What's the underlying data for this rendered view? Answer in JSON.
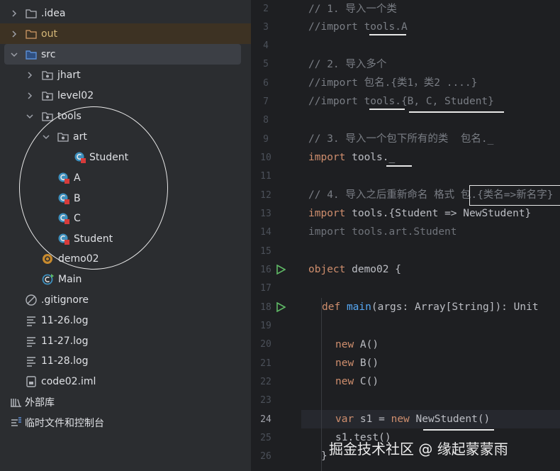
{
  "tree": [
    {
      "label": ".idea",
      "icon": "folder-icon",
      "chevron": "right"
    },
    {
      "label": "out",
      "icon": "folder-icon-orange",
      "chevron": "right",
      "selected": "out"
    },
    {
      "label": "src",
      "icon": "folder-icon-blue",
      "chevron": "down",
      "selected": "src"
    },
    {
      "label": "jhart",
      "icon": "package-icon",
      "chevron": "right"
    },
    {
      "label": "level02",
      "icon": "package-icon",
      "chevron": "right"
    },
    {
      "label": "tools",
      "icon": "package-icon",
      "chevron": "down"
    },
    {
      "label": "art",
      "icon": "package-icon",
      "chevron": "down"
    },
    {
      "label": "Student",
      "icon": "scala-class-icon"
    },
    {
      "label": "A",
      "icon": "scala-class-icon"
    },
    {
      "label": "B",
      "icon": "scala-class-icon"
    },
    {
      "label": "C",
      "icon": "scala-class-icon"
    },
    {
      "label": "Student",
      "icon": "scala-class-icon"
    },
    {
      "label": "demo02",
      "icon": "scala-object-icon"
    },
    {
      "label": "Main",
      "icon": "scala-main-icon"
    },
    {
      "label": ".gitignore",
      "icon": "ignore-file-icon"
    },
    {
      "label": "11-26.log",
      "icon": "text-file-icon"
    },
    {
      "label": "11-27.log",
      "icon": "text-file-icon"
    },
    {
      "label": "11-28.log",
      "icon": "text-file-icon"
    },
    {
      "label": "code02.iml",
      "icon": "module-file-icon"
    },
    {
      "label": "外部库",
      "icon": "library-icon"
    },
    {
      "label": "临时文件和控制台",
      "icon": "scratches-icon"
    }
  ],
  "line_numbers": [
    "2",
    "3",
    "4",
    "5",
    "6",
    "7",
    "8",
    "9",
    "10",
    "11",
    "12",
    "13",
    "14",
    "15",
    "16",
    "17",
    "18",
    "19",
    "20",
    "21",
    "22",
    "23",
    "24",
    "25",
    "26"
  ],
  "current_line": "24",
  "code": {
    "l2_comment": "// 1. 导入一个类",
    "l3_comment": "//import tools.A",
    "l5_comment": "// 2. 导入多个",
    "l6_comment": "//import 包名.{类1，类2 ....}",
    "l7_comment": "//import tools.{B, C, Student}",
    "l9_comment": "// 3. 导入一个包下所有的类  包名._",
    "l10_kw": "import",
    "l10_rest": " tools._",
    "l12_comment": "// 4. 导入之后重新命名 格式 包.{类名=>新名字}",
    "l13_kw": "import",
    "l13_rest": " tools.{Student => NewStudent}",
    "l14_text": "import tools.art.Student",
    "l16_kw": "object",
    "l16_rest": " demo02 {",
    "l18_kw": "def",
    "l18_fn": "main",
    "l18_rest": "(args: Array[String]): Unit",
    "l20_kw": "new",
    "l20_rest": " A()",
    "l21_kw": "new",
    "l21_rest": " B()",
    "l22_kw": "new",
    "l22_rest": " C()",
    "l24_kw1": "var",
    "l24_mid": " s1 = ",
    "l24_kw2": "new",
    "l24_rest": " NewStudent()",
    "l25_text": "s1.test()",
    "l26_text": "}"
  },
  "watermark": "掘金技术社区 @ 缘起蒙蒙雨",
  "colors": {
    "sidebar_bg": "#2b2d30",
    "editor_bg": "#1e1f22",
    "keyword": "#cf8e6d",
    "comment": "#7a7e85",
    "function": "#56a8f5",
    "run_icon": "#5fb865"
  }
}
